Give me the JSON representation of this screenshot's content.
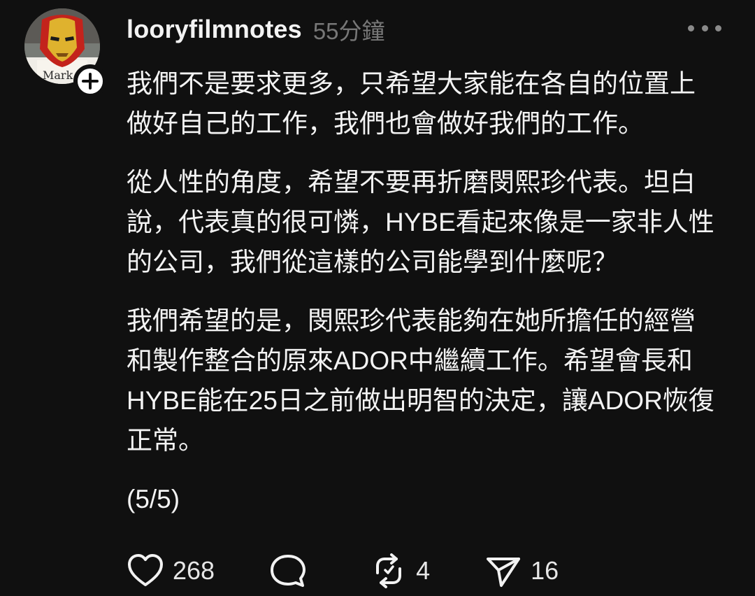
{
  "post": {
    "username": "looryfilmnotes",
    "timestamp": "55分鐘",
    "paragraphs": [
      "我們不是要求更多，只希望大家能在各自的位置上\n做好自己的工作，我們也會做好我們的工作。",
      "從人性的角度，希望不要再折磨閔熙珍代表。坦白\n說，代表真的很可憐，HYBE看起來像是一家非人性\n的公司，我們從這樣的公司能學到什麼呢？",
      "我們希望的是，閔熙珍代表能夠在她所擔任的經營\n和製作整合的原來ADOR中繼續工作。希望會長和\nHYBE能在25日之前做出明智的決定，讓ADOR恢復\n正常。",
      "(5/5)"
    ],
    "avatar_caption": "Mark"
  },
  "actions": {
    "likes": "268",
    "comments": "",
    "reposts": "4",
    "shares": "16"
  },
  "colors": {
    "background": "#101010",
    "text": "#f3f3f3",
    "muted": "#777777",
    "accent_mask": "#d8a12a",
    "mask_red": "#b7281f"
  },
  "icons": {
    "like": "heart-icon",
    "comment": "speech-bubble-icon",
    "repost": "repost-icon",
    "share": "paper-plane-icon",
    "follow": "plus-icon",
    "more": "more-horizontal-icon"
  }
}
